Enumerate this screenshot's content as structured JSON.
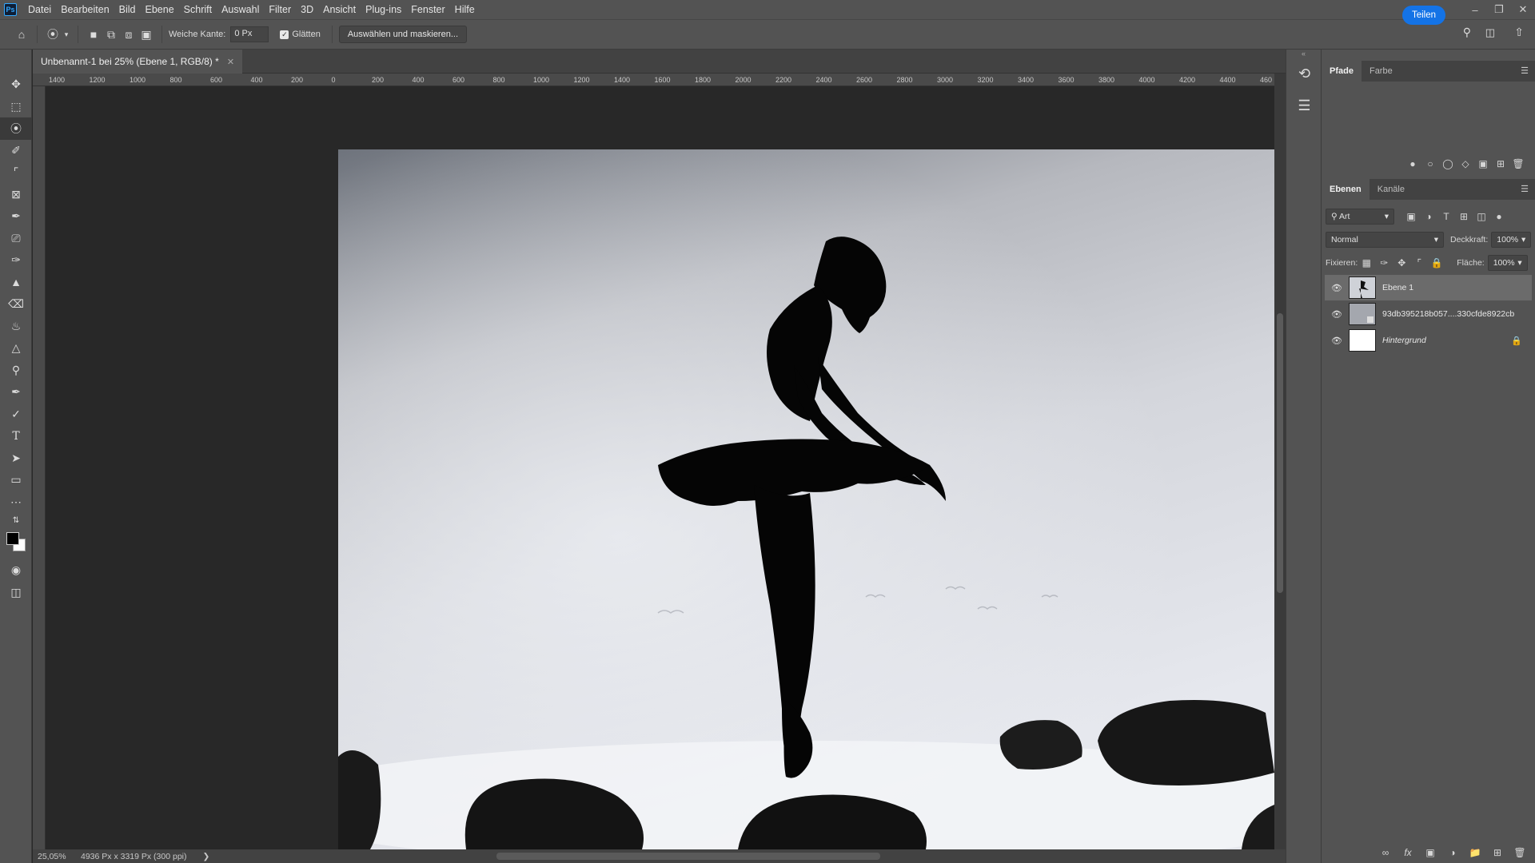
{
  "app": {
    "logo": "Ps"
  },
  "menu": [
    "Datei",
    "Bearbeiten",
    "Bild",
    "Ebene",
    "Schrift",
    "Auswahl",
    "Filter",
    "3D",
    "Ansicht",
    "Plug-ins",
    "Fenster",
    "Hilfe"
  ],
  "options": {
    "feather_label": "Weiche Kante:",
    "feather_value": "0 Px",
    "antialias_label": "Glätten",
    "select_mask_label": "Auswählen und maskieren...",
    "share_label": "Teilen"
  },
  "document": {
    "tab_title": "Unbenannt-1 bei 25% (Ebene 1, RGB/8) *",
    "zoom": "25,05%",
    "doc_info": "4936 Px x 3319 Px (300 ppi)"
  },
  "ruler": {
    "h_labels": [
      "1400",
      "1200",
      "1000",
      "800",
      "600",
      "400",
      "200",
      "0",
      "200",
      "400",
      "600",
      "800",
      "1000",
      "1200",
      "1400",
      "1600",
      "1800",
      "2000",
      "2200",
      "2400",
      "2600",
      "2800",
      "3000",
      "3200",
      "3400",
      "3600",
      "3800",
      "4000",
      "4200",
      "4400",
      "460"
    ]
  },
  "panels": {
    "top_tabs": [
      "Pfade",
      "Farbe"
    ],
    "layers_tabs": [
      "Ebenen",
      "Kanäle"
    ],
    "filter_kind": "Art",
    "blend_mode": "Normal",
    "opacity_label": "Deckkraft:",
    "opacity_value": "100%",
    "lock_label": "Fixieren:",
    "fill_label": "Fläche:",
    "fill_value": "100%"
  },
  "layers": [
    {
      "name": "Ebene 1",
      "selected": true
    },
    {
      "name": "93db395218b057....330cfde8922cb",
      "selected": false
    },
    {
      "name": "Hintergrund",
      "selected": false,
      "locked": true
    }
  ],
  "colors": {
    "accent": "#1473e6",
    "panel": "#535353",
    "canvas_bg": "#282828"
  }
}
